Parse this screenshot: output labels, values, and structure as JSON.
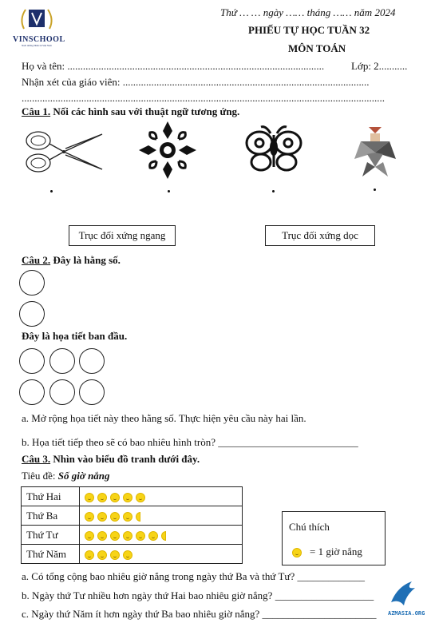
{
  "header": {
    "date_line": "Thứ … … ngày …… tháng …… năm 2024",
    "title": "PHIẾU TỰ HỌC TUẦN 32",
    "subject": "MÔN TOÁN",
    "logo_text": "VINSCHOOL",
    "logo_tagline": "Nuôi dưỡng Nhân tài Việt Nam"
  },
  "student": {
    "name_label": "Họ và tên: ...................................................................................................",
    "class_label": "Lớp: 2...........",
    "comment_label": "Nhận xét của giáo viên: ...............................................................................................",
    "comment_line": "............................................................................................................................................"
  },
  "q1": {
    "number": "Câu 1.",
    "text": "Nối các hình sau với thuật ngữ tương ứng.",
    "box_left": "Trục đối xứng ngang",
    "box_right": "Trục đối xứng dọc"
  },
  "q2": {
    "number": "Câu 2.",
    "text": "Đây là hằng số.",
    "pattern_text": "Đây là họa tiết ban đầu.",
    "part_a": "a. Mở rộng họa tiết này theo hằng số. Thực hiện yêu cầu này hai lần.",
    "part_b": "b. Họa tiết tiếp theo sẽ có bao nhiêu hình tròn? ___________________________"
  },
  "q3": {
    "number": "Câu 3.",
    "text": "Nhìn vào biểu đồ tranh dưới đây.",
    "chart_title_label": "Tiêu đề:",
    "chart_title": "Số giờ nắng",
    "legend_title": "Chú thích",
    "legend_value": "= 1 giờ nắng",
    "part_a": "a. Có tổng cộng bao nhiêu giờ nắng trong ngày thứ Ba và thứ Tư? _____________",
    "part_b": "b. Ngày thứ Tư nhiều hơn ngày thứ Hai bao nhiêu giờ nắng? ___________________",
    "part_c": "c. Ngày thứ Năm ít hơn ngày thứ Ba bao nhiêu giờ nắng? ______________________"
  },
  "chart_data": {
    "type": "table",
    "title": "Số giờ nắng",
    "categories": [
      "Thứ Hai",
      "Thứ Ba",
      "Thứ Tư",
      "Thứ Năm"
    ],
    "values": [
      5,
      4.5,
      6.5,
      4
    ],
    "unit": "1 giờ nắng"
  },
  "watermark": "AZMASIA.ORG",
  "colors": {
    "sun": "#f7d417",
    "logo": "#1d2f6b"
  }
}
